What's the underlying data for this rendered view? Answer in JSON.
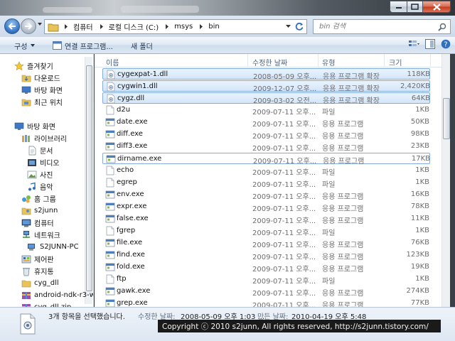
{
  "window": {
    "caption_buttons": [
      "minimize",
      "maximize",
      "close"
    ]
  },
  "address_bar": {
    "breadcrumbs": [
      "컴퓨터",
      "로컬 디스크 (C:)",
      "msys",
      "bin"
    ],
    "search_placeholder": "bin 검색"
  },
  "toolbar": {
    "organize_label": "구성",
    "open_label": "연결 프로그램...",
    "new_folder_label": "새 폴더"
  },
  "nav_pane": {
    "items": [
      {
        "label": "즐겨찾기",
        "icon": "star-icon"
      },
      {
        "label": "다운로드",
        "icon": "downloads-folder-icon"
      },
      {
        "label": "바탕 화면",
        "icon": "desktop-icon"
      },
      {
        "label": "최근 위치",
        "icon": "recent-places-icon"
      },
      {
        "label": "바탕 화면",
        "icon": "desktop-icon"
      },
      {
        "label": "라이브러리",
        "icon": "library-icon"
      },
      {
        "label": "문서",
        "icon": "documents-icon"
      },
      {
        "label": "비디오",
        "icon": "videos-icon"
      },
      {
        "label": "사진",
        "icon": "pictures-icon"
      },
      {
        "label": "음악",
        "icon": "music-icon"
      },
      {
        "label": "홈 그룹",
        "icon": "homegroup-icon"
      },
      {
        "label": "s2junn",
        "icon": "user-folder-icon"
      },
      {
        "label": "컴퓨터",
        "icon": "computer-icon"
      },
      {
        "label": "네트워크",
        "icon": "network-icon"
      },
      {
        "label": "S2JUNN-PC",
        "icon": "pc-icon"
      },
      {
        "label": "제어판",
        "icon": "control-panel-icon"
      },
      {
        "label": "휴지통",
        "icon": "recycle-bin-icon"
      },
      {
        "label": "cyg_dll",
        "icon": "folder-icon"
      },
      {
        "label": "android-ndk-r3-w",
        "icon": "archive-icon"
      },
      {
        "label": "cyg_dll.zip",
        "icon": "archive-icon"
      }
    ]
  },
  "file_list": {
    "columns": [
      "이름",
      "수정한 날짜",
      "유형",
      "크기"
    ],
    "rows": [
      {
        "name": "cygexpat-1.dll",
        "date": "2008-05-09 오후...",
        "type": "응용 프로그램 확장",
        "size": "118KB",
        "icon": "dll-icon",
        "selected": true
      },
      {
        "name": "cygwin1.dll",
        "date": "2009-12-07 오후...",
        "type": "응용 프로그램 확장",
        "size": "2,420KB",
        "icon": "dll-icon",
        "selected": true
      },
      {
        "name": "cygz.dll",
        "date": "2009-03-02 오전...",
        "type": "응용 프로그램 확장",
        "size": "64KB",
        "icon": "dll-icon",
        "selected": true
      },
      {
        "name": "d2u",
        "date": "2009-07-11 오후...",
        "type": "파일",
        "size": "1KB",
        "icon": "file-icon"
      },
      {
        "name": "date.exe",
        "date": "2009-07-11 오후...",
        "type": "응용 프로그램",
        "size": "50KB",
        "icon": "exe-icon"
      },
      {
        "name": "diff.exe",
        "date": "2009-07-11 오후...",
        "type": "응용 프로그램",
        "size": "98KB",
        "icon": "exe-icon"
      },
      {
        "name": "diff3.exe",
        "date": "2009-07-11 오후...",
        "type": "응용 프로그램",
        "size": "23KB",
        "icon": "exe-icon"
      },
      {
        "name": "dirname.exe",
        "date": "2009-07-11 오후...",
        "type": "응용 프로그램",
        "size": "17KB",
        "icon": "exe-icon",
        "focused": true
      },
      {
        "name": "echo",
        "date": "2009-07-11 오후...",
        "type": "파일",
        "size": "1KB",
        "icon": "file-icon"
      },
      {
        "name": "egrep",
        "date": "2009-07-11 오후...",
        "type": "파일",
        "size": "1KB",
        "icon": "file-icon"
      },
      {
        "name": "env.exe",
        "date": "2009-07-11 오후...",
        "type": "응용 프로그램",
        "size": "16KB",
        "icon": "exe-icon"
      },
      {
        "name": "expr.exe",
        "date": "2009-07-11 오후...",
        "type": "응용 프로그램",
        "size": "78KB",
        "icon": "exe-icon"
      },
      {
        "name": "false.exe",
        "date": "2009-07-11 오후...",
        "type": "응용 프로그램",
        "size": "11KB",
        "icon": "exe-icon"
      },
      {
        "name": "fgrep",
        "date": "2009-07-11 오후...",
        "type": "파일",
        "size": "1KB",
        "icon": "file-icon"
      },
      {
        "name": "file.exe",
        "date": "2009-07-11 오후...",
        "type": "응용 프로그램",
        "size": "76KB",
        "icon": "exe-icon"
      },
      {
        "name": "find.exe",
        "date": "2009-07-11 오후...",
        "type": "응용 프로그램",
        "size": "123KB",
        "icon": "exe-icon"
      },
      {
        "name": "fold.exe",
        "date": "2009-07-11 오후...",
        "type": "응용 프로그램",
        "size": "19KB",
        "icon": "exe-icon"
      },
      {
        "name": "ftp",
        "date": "2009-07-11 오후...",
        "type": "파일",
        "size": "1KB",
        "icon": "file-icon"
      },
      {
        "name": "gawk.exe",
        "date": "2009-07-11 오후...",
        "type": "응용 프로그램",
        "size": "274KB",
        "icon": "exe-icon"
      },
      {
        "name": "grep.exe",
        "date": "2009-07-11 오후...",
        "type": "응용 프로그램",
        "size": "77KB",
        "icon": "exe-icon"
      }
    ]
  },
  "details": {
    "selection_count": "3개 항목을 선택했습니다.",
    "modified_label": "수정한 날짜:",
    "modified_value": "2008-05-09 오후 1:03 ...",
    "created_label": "만든 날짜:",
    "created_value": "2010-04-19 오후 5:48"
  },
  "watermark": "Copyright ⓒ 2010 s2junn, All rights reserved, http://s2junn.tistory.com/",
  "colors": {
    "selection_fill": "#d9e8fb",
    "selection_border": "#84acdd",
    "toolbar_text": "#1e3250"
  }
}
